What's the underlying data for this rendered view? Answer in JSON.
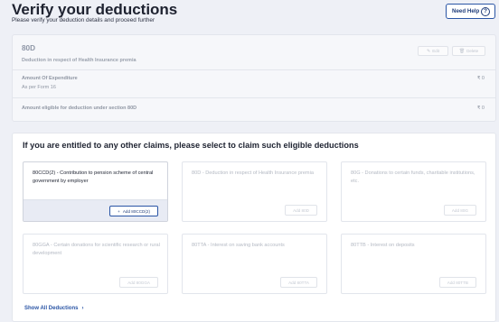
{
  "header": {
    "title": "Verify your deductions",
    "subtitle": "Please verify your deduction details and proceed further",
    "help_label": "Need Help",
    "help_icon": "?"
  },
  "deduction_80d": {
    "code": "80D",
    "description": "Deduction in respect of Health Insurance premia",
    "edit_label": "Edit",
    "delete_label": "Delete",
    "expenditure_label": "Amount Of Expenditure",
    "expenditure_source": "As per Form 16",
    "expenditure_value": "₹ 0",
    "eligible_label": "Amount eligible for deduction under section 80D",
    "eligible_value": "₹ 0"
  },
  "claims": {
    "title": "If you are entitled to any other claims, please select to claim such eligible deductions",
    "tiles": [
      {
        "text": "80CCD(2) - Contribution to pension scheme of central government by employer",
        "button": "Add 80CCD(2)",
        "active": true
      },
      {
        "text": "80D - Deduction in respect of Health Insurance premia",
        "button": "Add 80D",
        "active": false
      },
      {
        "text": "80G - Donations to certain funds, charitable institutions, etc.",
        "button": "Add 80G",
        "active": false
      },
      {
        "text": "80GGA - Certain donations for scientific research or rural development",
        "button": "Add 80GGA",
        "active": false
      },
      {
        "text": "80TTA - Interest on saving bank accounts",
        "button": "Add 80TTA",
        "active": false
      },
      {
        "text": "80TTB - Interest on deposits",
        "button": "Add 80TTB",
        "active": false
      }
    ],
    "show_all_label": "Show All Deductions",
    "show_all_icon": "›"
  },
  "colors": {
    "primary": "#2a55a5",
    "background": "#eef0f6",
    "card_disabled": "#f6f7fa",
    "active_footer": "#e8ebf4"
  }
}
